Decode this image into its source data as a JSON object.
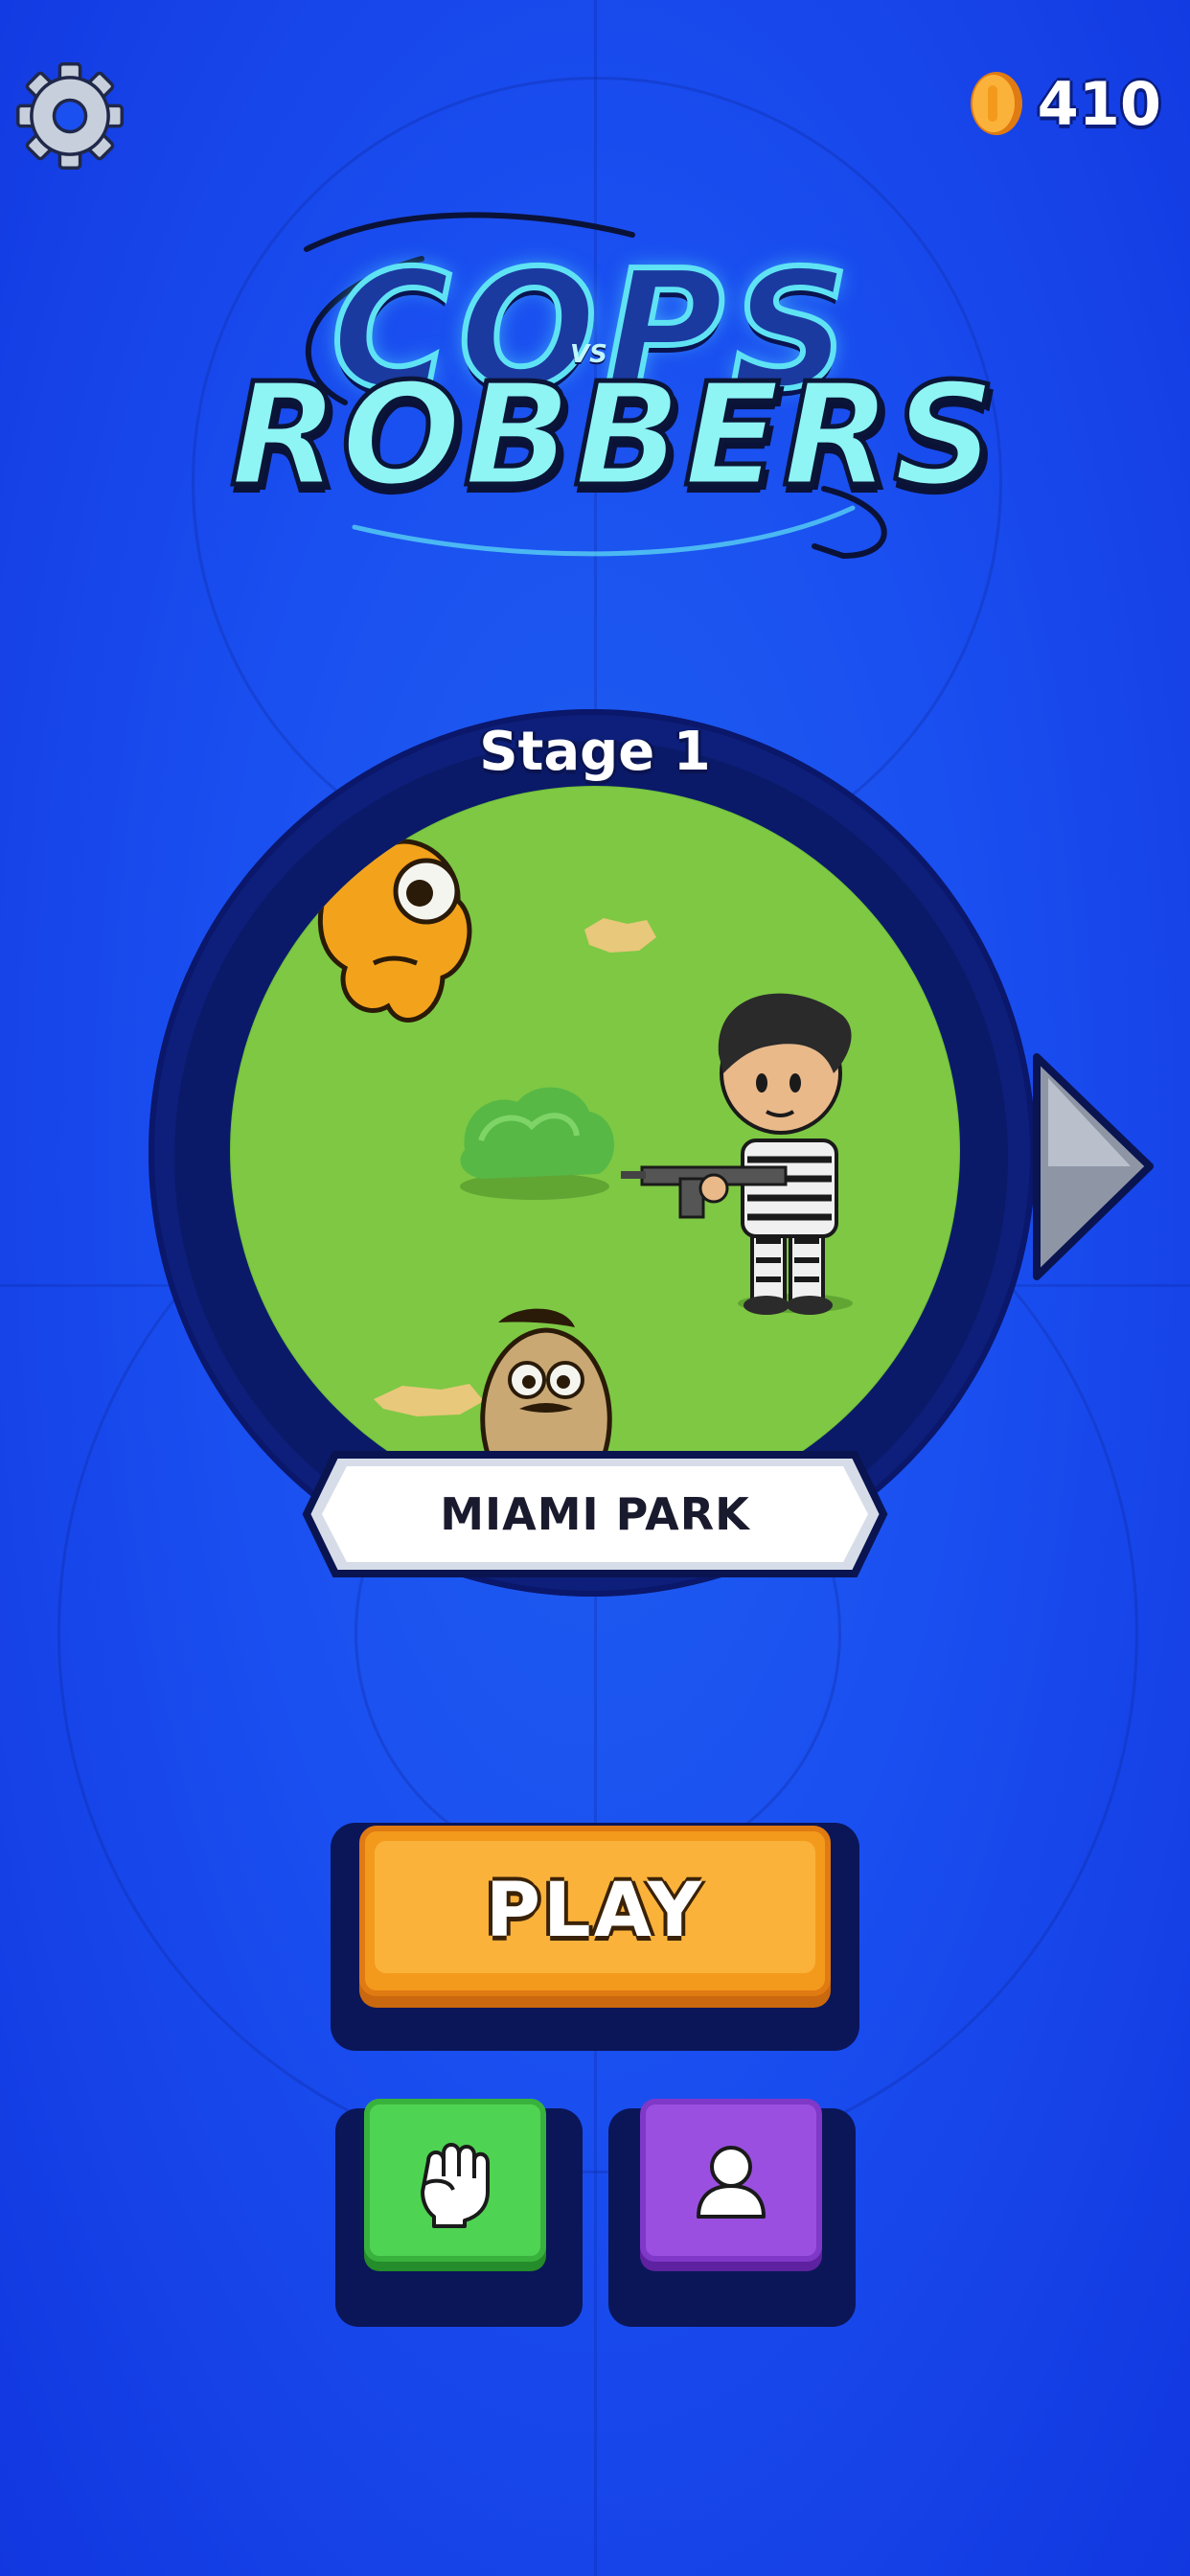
{
  "header": {
    "coins": "410"
  },
  "logo": {
    "line1": "COPS",
    "vs": "VS",
    "line2": "ROBBERS"
  },
  "stage": {
    "title": "Stage 1",
    "name": "MIAMI PARK"
  },
  "actions": {
    "play_label": "PLAY"
  },
  "icons": {
    "settings": "gear-icon",
    "coin": "coin-icon",
    "next": "chevron-right-icon",
    "fight": "fist-icon",
    "profile": "user-icon"
  },
  "colors": {
    "background": "#1a4ff0",
    "play_button": "#f39a1c",
    "fight_button": "#4fd353",
    "profile_button": "#9a4fe0"
  }
}
